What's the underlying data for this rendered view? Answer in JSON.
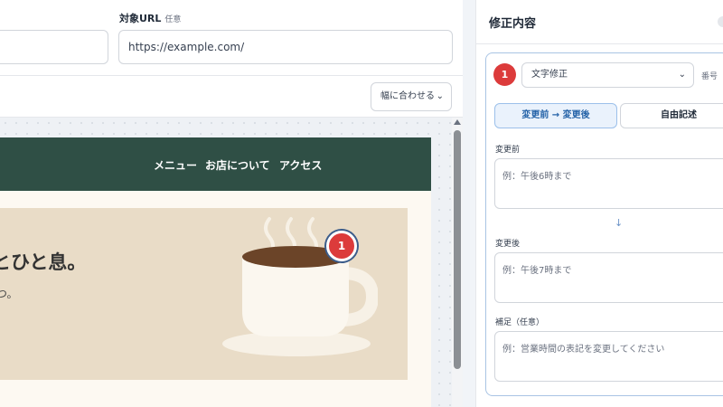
{
  "form": {
    "left_field_value": "",
    "url_label": "対象URL",
    "url_optional": "任意",
    "url_value": "https://example.com/"
  },
  "preview": {
    "fit_label": "幅に合わせる",
    "nav": [
      "メニュー",
      "お店について",
      "アクセス"
    ],
    "hero_title": "っとひと息。",
    "hero_sub": "やつ。",
    "pin_number": "1"
  },
  "panel": {
    "title": "修正内容",
    "item_number": "1",
    "type_value": "文字修正",
    "number_label": "番号",
    "tabs": {
      "before_after": "変更前 → 変更後",
      "free": "自由記述"
    },
    "before": {
      "label": "変更前",
      "placeholder": "例：午後6時まで"
    },
    "arrow": "↓",
    "after": {
      "label": "変更後",
      "placeholder": "例：午後7時まで"
    },
    "note": {
      "label": "補足（任意）",
      "placeholder": "例：営業時間の表記を変更してください"
    }
  },
  "colors": {
    "nav_bg": "#2f4f45",
    "hero_bg": "#e9dcc7",
    "badge": "#dc3b3b",
    "accent": "#2563a8"
  }
}
